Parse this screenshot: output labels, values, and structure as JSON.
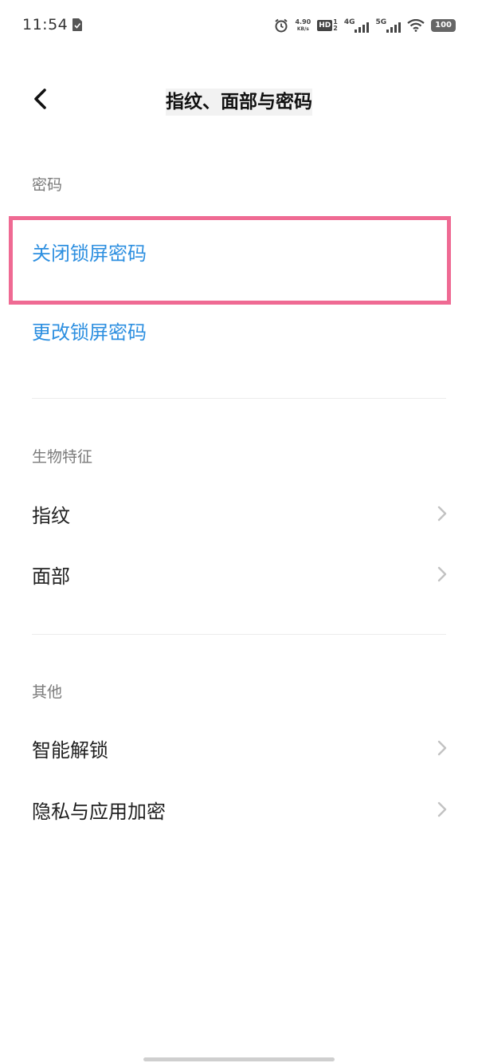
{
  "status_bar": {
    "time": "11:54",
    "net_speed_value": "4.90",
    "net_speed_unit": "KB/s",
    "hd_label": "HD",
    "hd_sub_top": "1",
    "hd_sub_bottom": "2",
    "signal1_label": "4G",
    "signal2_label": "5G",
    "battery": "100"
  },
  "header": {
    "title": "指纹、面部与密码"
  },
  "sections": {
    "password": {
      "header": "密码",
      "items": [
        {
          "label": "关闭锁屏密码"
        },
        {
          "label": "更改锁屏密码"
        }
      ]
    },
    "biometrics": {
      "header": "生物特征",
      "items": [
        {
          "label": "指纹"
        },
        {
          "label": "面部"
        }
      ]
    },
    "other": {
      "header": "其他",
      "items": [
        {
          "label": "智能解锁"
        },
        {
          "label": "隐私与应用加密"
        }
      ]
    }
  },
  "colors": {
    "accent_blue": "#2d8fe0",
    "highlight_pink": "#ef6a93",
    "section_gray": "#7a7a7a"
  }
}
